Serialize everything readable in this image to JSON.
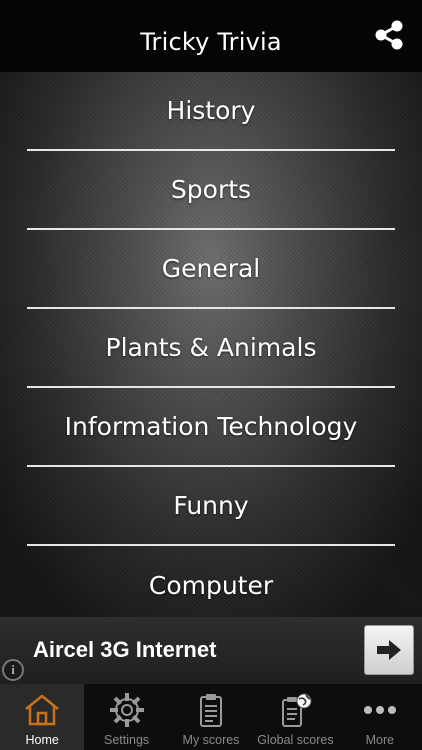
{
  "header": {
    "title": "Tricky Trivia",
    "share_icon": "share-icon"
  },
  "menu": {
    "items": [
      {
        "label": "History"
      },
      {
        "label": "Sports"
      },
      {
        "label": "General"
      },
      {
        "label": "Plants & Animals"
      },
      {
        "label": "Information Technology"
      },
      {
        "label": "Funny"
      },
      {
        "label": "Computer"
      }
    ]
  },
  "ad": {
    "text": "Aircel 3G Internet",
    "button_icon": "arrow-right-icon",
    "info_glyph": "i"
  },
  "tabs": [
    {
      "label": "Home",
      "icon": "home-icon",
      "active": true
    },
    {
      "label": "Settings",
      "icon": "gear-icon"
    },
    {
      "label": "My scores",
      "icon": "clipboard-icon"
    },
    {
      "label": "Global scores",
      "icon": "globe-clipboard-icon"
    },
    {
      "label": "More",
      "icon": "more-icon"
    }
  ],
  "colors": {
    "accent": "#c8731c",
    "header_bg": "#050505",
    "tab_bg": "#0d0d0d",
    "active_tab_bg": "#2a2a2a"
  }
}
